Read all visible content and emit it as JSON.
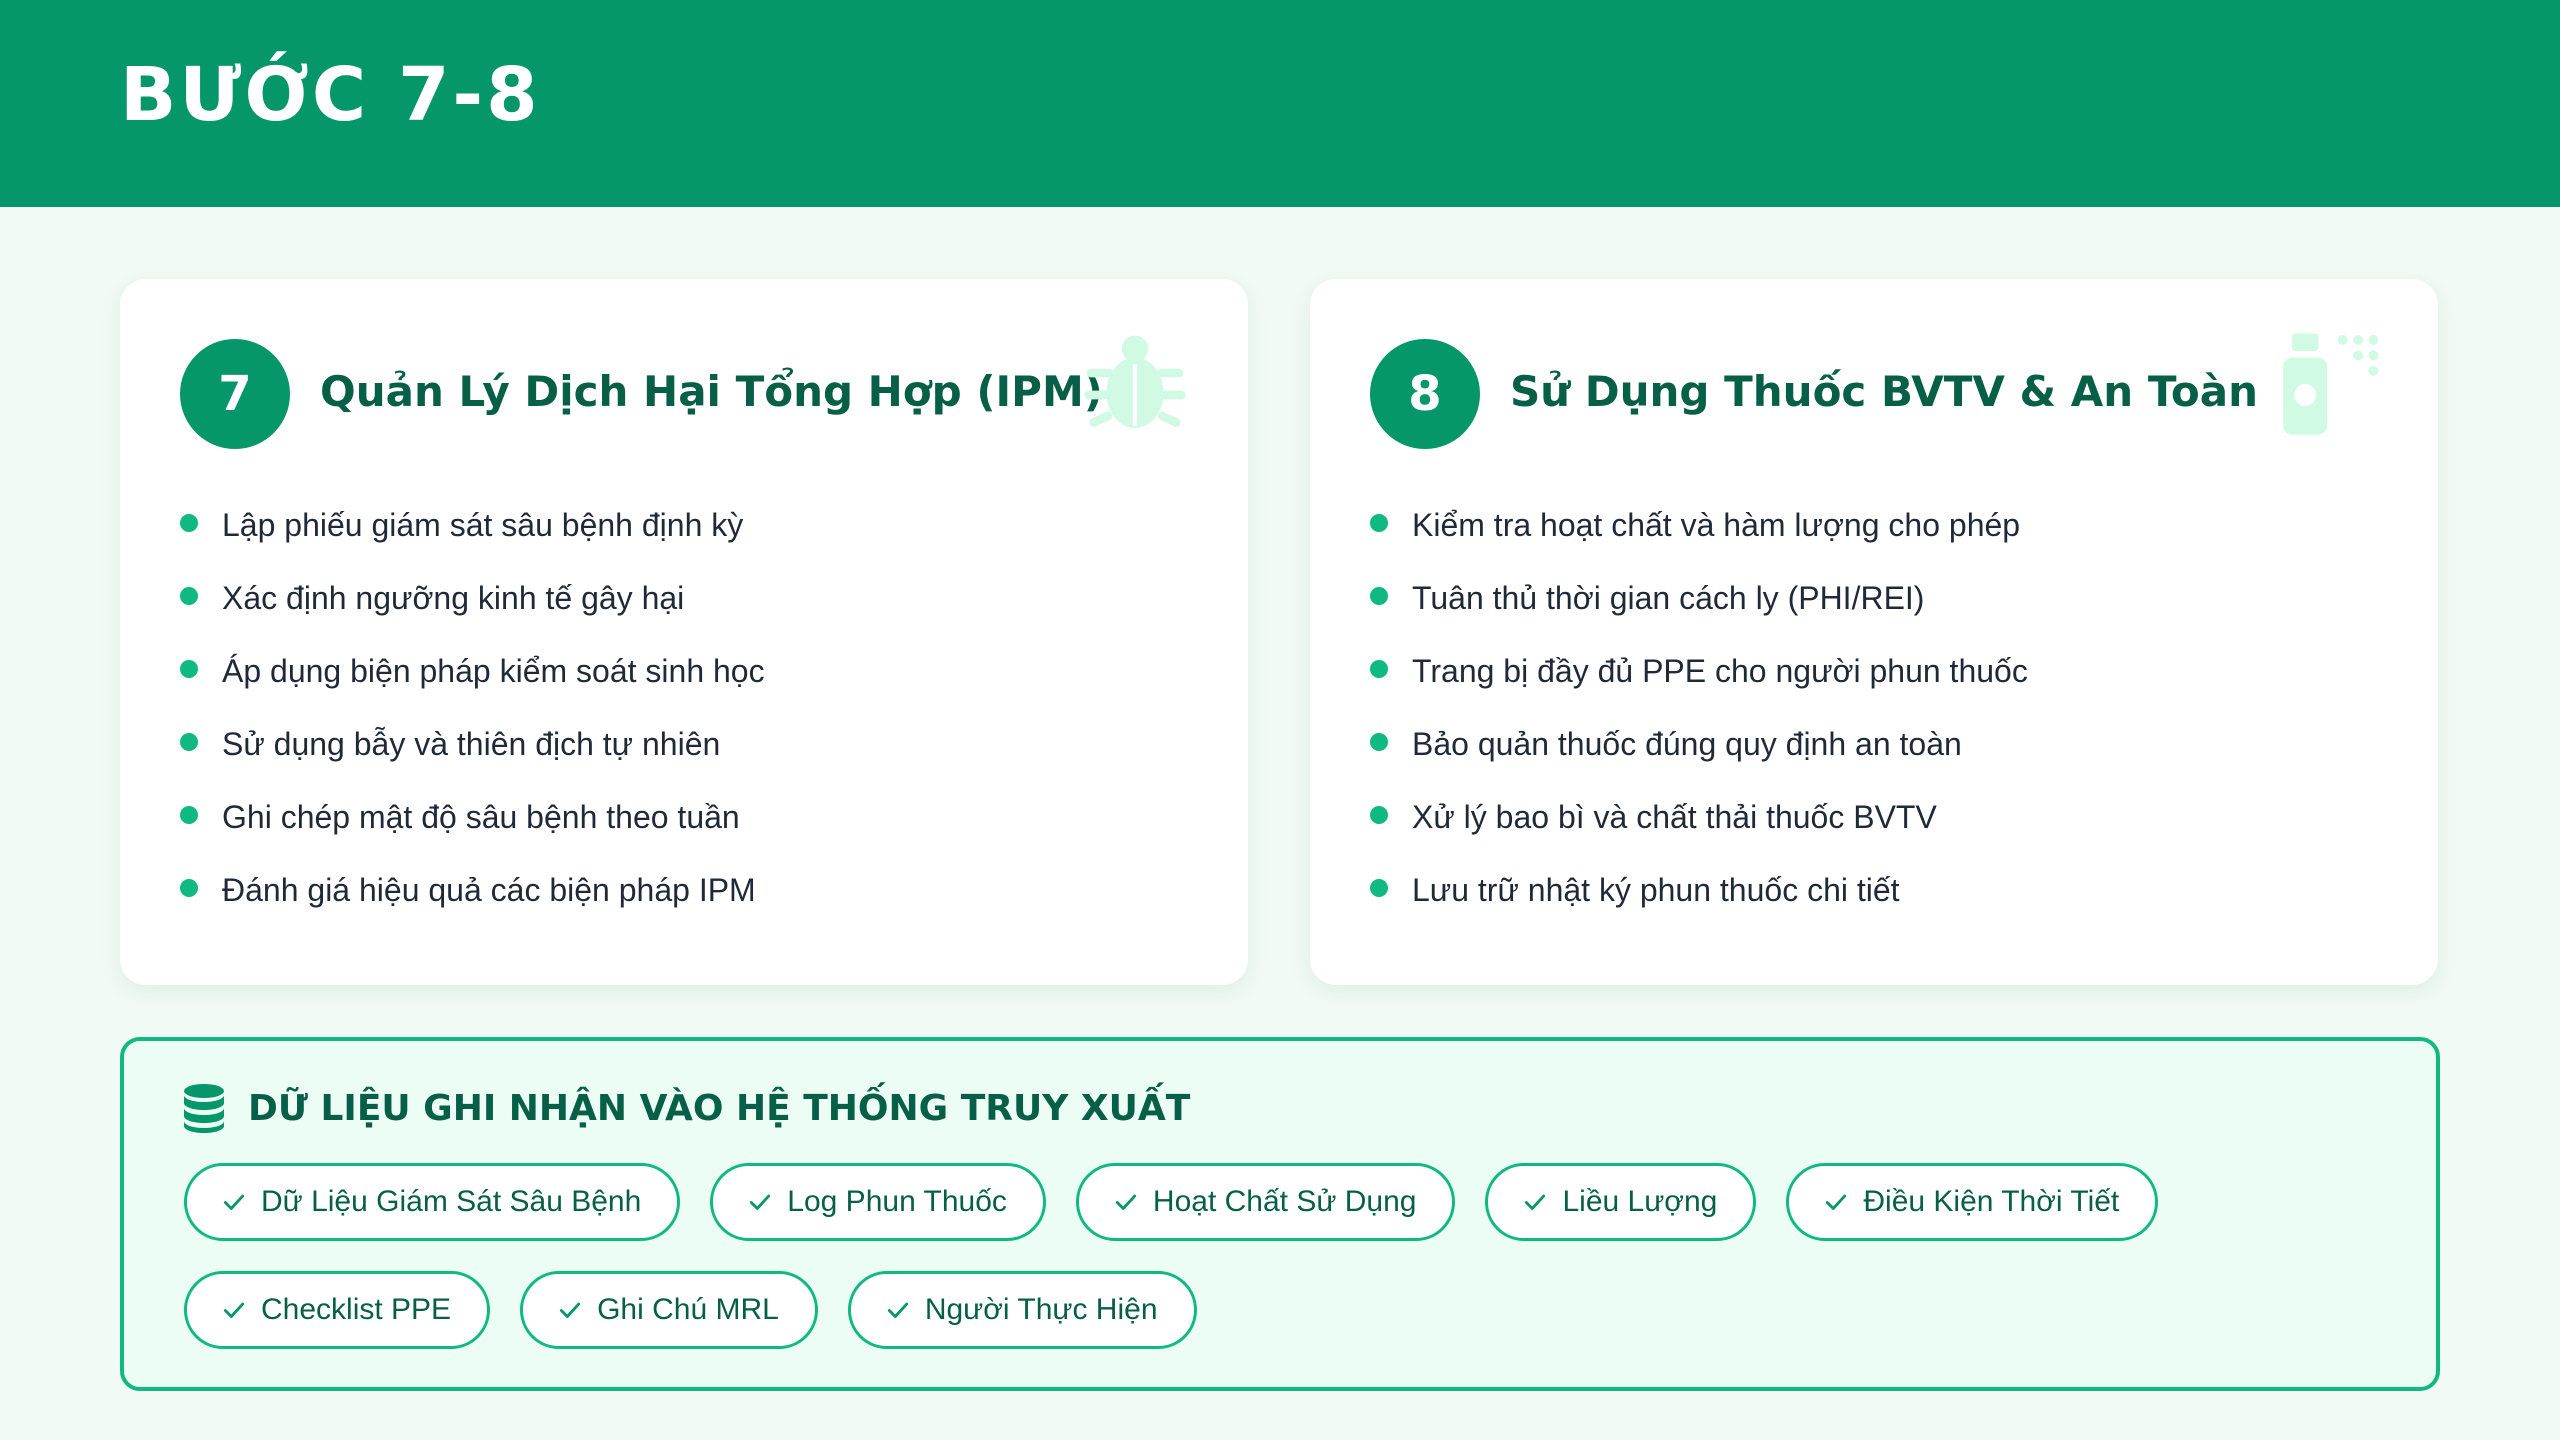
{
  "header": {
    "title": "BƯỚC 7-8"
  },
  "steps": [
    {
      "number": "7",
      "title": "Quản Lý Dịch Hại Tổng Hợp (IPM)",
      "icon": "bug-icon",
      "items": [
        "Lập phiếu giám sát sâu bệnh định kỳ",
        "Xác định ngưỡng kinh tế gây hại",
        "Áp dụng biện pháp kiểm soát sinh học",
        "Sử dụng bẫy và thiên địch tự nhiên",
        "Ghi chép mật độ sâu bệnh theo tuần",
        "Đánh giá hiệu quả các biện pháp IPM"
      ]
    },
    {
      "number": "8",
      "title": "Sử Dụng Thuốc BVTV & An Toàn",
      "icon": "spray-can-icon",
      "items": [
        "Kiểm tra hoạt chất và hàm lượng cho phép",
        "Tuân thủ thời gian cách ly (PHI/REI)",
        "Trang bị đầy đủ PPE cho người phun thuốc",
        "Bảo quản thuốc đúng quy định an toàn",
        "Xử lý bao bì và chất thải thuốc BVTV",
        "Lưu trữ nhật ký phun thuốc chi tiết"
      ]
    }
  ],
  "data_panel": {
    "title": "DỮ LIỆU GHI NHẬN VÀO HỆ THỐNG TRUY XUẤT",
    "icon": "database-icon",
    "chips": [
      "Dữ Liệu Giám Sát Sâu Bệnh",
      "Log Phun Thuốc",
      "Hoạt Chất Sử Dụng",
      "Liều Lượng",
      "Điều Kiện Thời Tiết",
      "Checklist PPE",
      "Ghi Chú MRL",
      "Người Thực Hiện"
    ]
  },
  "colors": {
    "primary": "#059669",
    "accent": "#10b981",
    "dark_text": "#065f46",
    "background": "#f1faf5",
    "panel_bg": "#ecfdf5"
  }
}
